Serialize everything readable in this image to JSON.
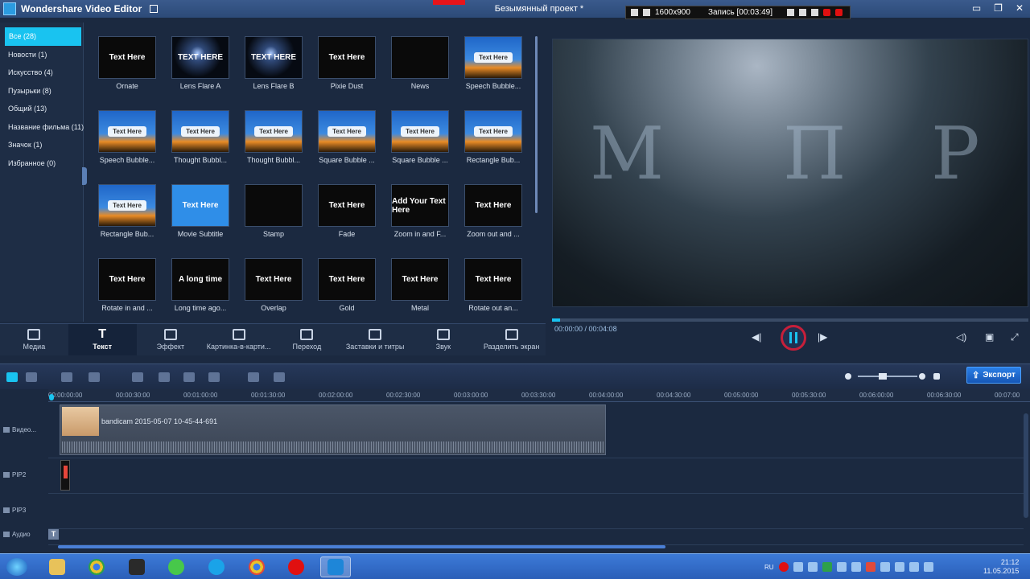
{
  "titlebar": {
    "app_title": "Wondershare Video Editor",
    "project_title": "Безымянный проект *"
  },
  "recorder": {
    "resolution": "1600x900",
    "status": "Запись [00:03:49]"
  },
  "window_controls": {
    "minimize": "▭",
    "restore": "❐",
    "close": "✕"
  },
  "categories": [
    {
      "label": "Все (28)",
      "active": true
    },
    {
      "label": "Новости (1)"
    },
    {
      "label": "Искусство (4)"
    },
    {
      "label": "Пузырьки (8)"
    },
    {
      "label": "Общий (13)"
    },
    {
      "label": "Название фильма (11)"
    },
    {
      "label": "Значок (1)"
    },
    {
      "label": "Избранное (0)"
    }
  ],
  "effects": [
    {
      "label": "Ornate",
      "thumb_text": "Text Here",
      "style": "dark"
    },
    {
      "label": "Lens Flare A",
      "thumb_text": "TEXT HERE",
      "style": "shine"
    },
    {
      "label": "Lens Flare B",
      "thumb_text": "TEXT HERE",
      "style": "shine"
    },
    {
      "label": "Pixie Dust",
      "thumb_text": "Text Here",
      "style": "dark"
    },
    {
      "label": "News",
      "thumb_text": "",
      "style": "dark"
    },
    {
      "label": "Speech Bubble...",
      "thumb_text": "Text Here",
      "style": "sky"
    },
    {
      "label": "Speech Bubble...",
      "thumb_text": "Text Here",
      "style": "sky"
    },
    {
      "label": "Thought Bubbl...",
      "thumb_text": "Text Here",
      "style": "sky"
    },
    {
      "label": "Thought Bubbl...",
      "thumb_text": "Text Here",
      "style": "sky"
    },
    {
      "label": "Square Bubble ...",
      "thumb_text": "Text Here",
      "style": "sky"
    },
    {
      "label": "Square Bubble ...",
      "thumb_text": "Text Here",
      "style": "sky"
    },
    {
      "label": "Rectangle Bub...",
      "thumb_text": "Text Here",
      "style": "sky"
    },
    {
      "label": "Rectangle Bub...",
      "thumb_text": "Text Here",
      "style": "sky"
    },
    {
      "label": "Movie Subtitle",
      "thumb_text": "Text Here",
      "style": "blue"
    },
    {
      "label": "Stamp",
      "thumb_text": "",
      "style": "dark"
    },
    {
      "label": "Fade",
      "thumb_text": "Text Here",
      "style": "dark"
    },
    {
      "label": "Zoom in and F...",
      "thumb_text": "Add Your Text Here",
      "style": "dark"
    },
    {
      "label": "Zoom out and ...",
      "thumb_text": "Text Here",
      "style": "dark"
    },
    {
      "label": "Rotate in and ...",
      "thumb_text": "Text Here",
      "style": "dark"
    },
    {
      "label": "Long time ago...",
      "thumb_text": "A long time",
      "style": "dark"
    },
    {
      "label": "Overlap",
      "thumb_text": "Text Here",
      "style": "dark"
    },
    {
      "label": "Gold",
      "thumb_text": "Text Here",
      "style": "dark"
    },
    {
      "label": "Metal",
      "thumb_text": "Text Here",
      "style": "dark"
    },
    {
      "label": "Rotate out an...",
      "thumb_text": "Text Here",
      "style": "dark"
    }
  ],
  "tools": [
    {
      "label": "Медиа"
    },
    {
      "label": "Текст",
      "active": true
    },
    {
      "label": "Эффект"
    },
    {
      "label": "Картинка-в-карти..."
    },
    {
      "label": "Переход"
    },
    {
      "label": "Заставки и титры"
    },
    {
      "label": "Звук"
    },
    {
      "label": "Разделить экран"
    }
  ],
  "preview": {
    "letters": [
      "М",
      "П",
      "Р"
    ],
    "timecode": "00:00:00 / 00:04:08"
  },
  "export": {
    "label": "Экспорт"
  },
  "ruler": [
    "00:00:00:00",
    "00:00:30:00",
    "00:01:00:00",
    "00:01:30:00",
    "00:02:00:00",
    "00:02:30:00",
    "00:03:00:00",
    "00:03:30:00",
    "00:04:00:00",
    "00:04:30:00",
    "00:05:00:00",
    "00:05:30:00",
    "00:06:00:00",
    "00:06:30:00",
    "00:07:00"
  ],
  "tracks": [
    {
      "label": "Видео..."
    },
    {
      "label": "PIP2"
    },
    {
      "label": "PIP3"
    },
    {
      "label": "Аудио"
    }
  ],
  "clip": {
    "name": "bandicam 2015-05-07 10-45-44-691"
  },
  "text_clip": "T",
  "taskbar": {
    "tray_lang": "RU",
    "time": "21:12",
    "date": "11.05.2015"
  },
  "colors": {
    "accent": "#19c3f0",
    "rec": "#e01010",
    "export": "#1657b6"
  }
}
